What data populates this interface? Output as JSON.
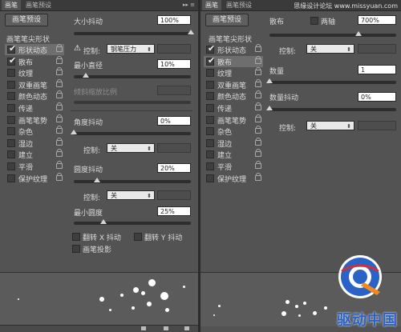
{
  "left": {
    "tabs": [
      "画笔",
      "画笔预设"
    ],
    "tab_controls": "▸▸ ≡",
    "preset_button": "画笔预设",
    "tips_title": "画笔笔尖形状",
    "tips": [
      {
        "label": "形状动态",
        "checked": true,
        "selected": true
      },
      {
        "label": "散布",
        "checked": true,
        "selected": false
      },
      {
        "label": "纹理",
        "checked": false,
        "selected": false
      },
      {
        "label": "双重画笔",
        "checked": false,
        "selected": false
      },
      {
        "label": "颜色动态",
        "checked": false,
        "selected": false
      },
      {
        "label": "传递",
        "checked": false,
        "selected": false
      },
      {
        "label": "画笔笔势",
        "checked": false,
        "selected": false
      },
      {
        "label": "杂色",
        "checked": false,
        "selected": false
      },
      {
        "label": "湿边",
        "checked": false,
        "selected": false
      },
      {
        "label": "建立",
        "checked": false,
        "selected": false
      },
      {
        "label": "平滑",
        "checked": false,
        "selected": false
      },
      {
        "label": "保护纹理",
        "checked": false,
        "selected": false
      }
    ],
    "size_jitter_label": "大小抖动",
    "size_jitter_value": "100%",
    "size_jitter_level": 1.0,
    "control_label": "控制:",
    "control_pen_value": "钢笔压力",
    "min_diameter_label": "最小直径",
    "min_diameter_value": "10%",
    "min_diameter_level": 0.1,
    "tilt_scale_label": "倾斜缩放比例",
    "angle_jitter_label": "角度抖动",
    "angle_jitter_value": "0%",
    "angle_jitter_level": 0.0,
    "control_off": "关",
    "roundness_jitter_label": "圆度抖动",
    "roundness_jitter_value": "20%",
    "roundness_jitter_level": 0.2,
    "min_roundness_label": "最小圆度",
    "min_roundness_value": "25%",
    "min_roundness_level": 0.25,
    "flip_x_label": "翻转 X 抖动",
    "flip_y_label": "翻转 Y 抖动",
    "brush_projection_label": "画笔投影"
  },
  "right": {
    "tabs": [
      "画笔",
      "画笔预设"
    ],
    "watermark": "思缘设计论坛 www.missyuan.com",
    "preset_button": "画笔预设",
    "tips_title": "画笔笔尖形状",
    "tips": [
      {
        "label": "形状动态",
        "checked": true,
        "selected": false
      },
      {
        "label": "散布",
        "checked": true,
        "selected": true
      },
      {
        "label": "纹理",
        "checked": false,
        "selected": false
      },
      {
        "label": "双重画笔",
        "checked": false,
        "selected": false
      },
      {
        "label": "颜色动态",
        "checked": false,
        "selected": false
      },
      {
        "label": "传递",
        "checked": false,
        "selected": false
      },
      {
        "label": "画笔笔势",
        "checked": false,
        "selected": false
      },
      {
        "label": "杂色",
        "checked": false,
        "selected": false
      },
      {
        "label": "湿边",
        "checked": false,
        "selected": false
      },
      {
        "label": "建立",
        "checked": false,
        "selected": false
      },
      {
        "label": "平滑",
        "checked": false,
        "selected": false
      },
      {
        "label": "保护纹理",
        "checked": false,
        "selected": false
      }
    ],
    "scatter_label": "散布",
    "both_axes_label": "两轴",
    "scatter_value": "700%",
    "scatter_level": 0.7,
    "control_label": "控制:",
    "control_off": "关",
    "count_label": "数量",
    "count_value": "1",
    "count_level": 0.0,
    "count_jitter_label": "数量抖动",
    "count_jitter_value": "0%",
    "count_jitter_level": 0.0,
    "logo_text": "驱动中国"
  },
  "colors": {
    "panel": "#535353",
    "selected_row": "#6e6e6e",
    "logo_blue": "#2a62c8",
    "logo_orange": "#f08a1c"
  }
}
